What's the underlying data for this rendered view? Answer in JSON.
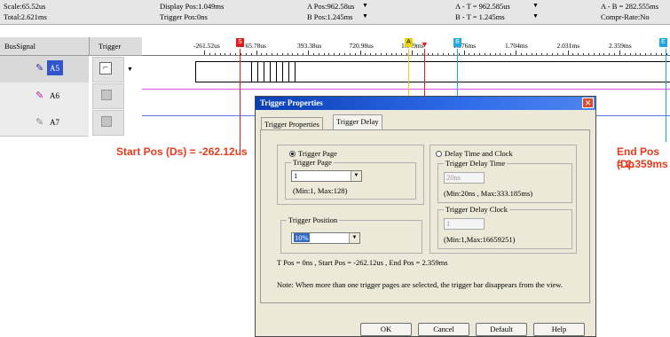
{
  "info": {
    "scale": "Scale:65.52us",
    "total": "Total:2.621ms",
    "display_pos": "Display Pos:1.049ms",
    "trigger_pos": "Trigger Pos:0ns",
    "a_pos": "A Pos:962.58us",
    "b_pos": "B Pos:1.245ms",
    "a_t": "A - T = 962.585us",
    "b_t": "B - T = 1.245ms",
    "a_b": "A - B = 282.555ms",
    "compr": "Compr-Rate:No"
  },
  "columns": {
    "bus_signal": "BusSignal",
    "trigger": "Trigger"
  },
  "signals": [
    {
      "name": "A5"
    },
    {
      "name": "A6"
    },
    {
      "name": "A7"
    }
  ],
  "time_ticks": [
    "-261.52us",
    "65.78us",
    "393.38us",
    "720.98us",
    "1.049ms",
    "1.376ms",
    "1.704ms",
    "2.031ms",
    "2.359ms"
  ],
  "markers": {
    "a": "A",
    "b": "B",
    "start": "S",
    "end": "E"
  },
  "annotations": {
    "start_pos": "Start Pos (Ds) = -262.12us",
    "end_pos_line1": "End Pos (Dp",
    "end_pos_line2": "= 2.359ms"
  },
  "dialog": {
    "title": "Trigger Properties",
    "tabs": [
      "Trigger Properties",
      "Trigger Delay"
    ],
    "trigger_page_radio": "Trigger Page",
    "trigger_page_group": "Trigger Page",
    "trigger_page_value": "1",
    "trigger_page_range": "(Min:1, Max:128)",
    "trigger_position_group": "Trigger Position",
    "trigger_position_value": "10%",
    "delay_radio": "Delay Time and Clock",
    "delay_time_group": "Trigger Delay Time",
    "delay_time_value": "20ns",
    "delay_time_range": "(Min:20ns , Max:333.185ms)",
    "delay_clock_group": "Trigger Delay Clock",
    "delay_clock_value": "1",
    "delay_clock_range": "(Min:1,Max:16659251)",
    "positions_line": "T Pos = 0ns , Start Pos = -262.12us , End Pos = 2.359ms",
    "note": "Note: When more than one trigger pages are selected, the trigger bar disappears from the view.",
    "buttons": {
      "ok": "OK",
      "cancel": "Cancel",
      "default": "Default",
      "help": "Help"
    }
  },
  "colors": {
    "start_marker": "#e01b1b",
    "a_marker": "#e8d400",
    "b_marker": "#1fa7e0",
    "trigger_marker": "#e01b1b",
    "pink_line": "#e050e0",
    "blue_line": "#5a7ee8",
    "annotation": "#e83a1c"
  }
}
